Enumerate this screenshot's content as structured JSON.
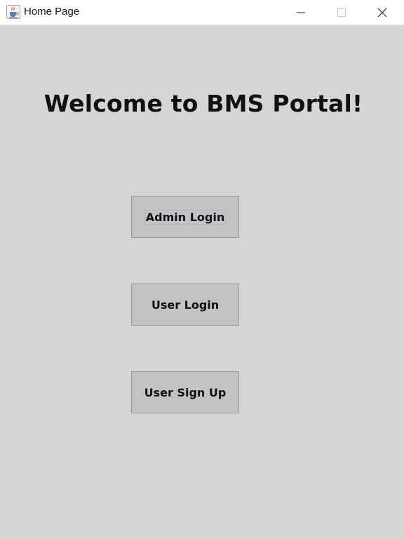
{
  "window": {
    "title": "Home Page",
    "icon": "java-cup-icon",
    "controls": {
      "minimize_icon": "minimize-icon",
      "maximize_icon": "maximize-icon",
      "close_icon": "close-icon"
    }
  },
  "main": {
    "heading": "Welcome to BMS Portal!",
    "buttons": {
      "admin_login": "Admin Login",
      "user_login": "User Login",
      "user_sign_up": "User Sign Up"
    }
  },
  "colors": {
    "background": "#d5d5d5",
    "button_fill": "#c3c3c3",
    "button_border": "#8e99a6",
    "titlebar": "#ffffff"
  }
}
